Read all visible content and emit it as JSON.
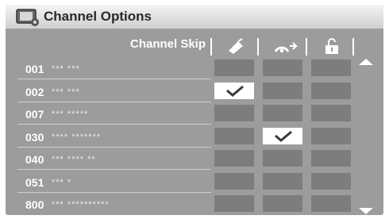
{
  "window": {
    "title": "Channel Options"
  },
  "columns": {
    "skip_label": "Channel Skip",
    "icons": [
      "antenna-off-icon",
      "favorite-arc-icon",
      "unlock-icon"
    ]
  },
  "rows": [
    {
      "number": "001",
      "name": "*** ***",
      "checks": [
        false,
        false,
        false
      ]
    },
    {
      "number": "002",
      "name": "*** ***",
      "checks": [
        true,
        false,
        false
      ]
    },
    {
      "number": "007",
      "name": "*** *****",
      "checks": [
        false,
        false,
        false
      ]
    },
    {
      "number": "030",
      "name": "**** *******",
      "checks": [
        false,
        true,
        false
      ]
    },
    {
      "number": "040",
      "name": "*** **** **",
      "checks": [
        false,
        false,
        false
      ]
    },
    {
      "number": "051",
      "name": "*** *",
      "checks": [
        false,
        false,
        false
      ]
    },
    {
      "number": "800",
      "name": "*** **********",
      "checks": [
        false,
        false,
        false
      ]
    }
  ],
  "scroll": {
    "up_icon": "scroll-up-icon",
    "down_icon": "scroll-down-icon"
  },
  "colors": {
    "panel": "#9c9c9c",
    "cell": "#7d7d7d",
    "highlight": "#ffffff"
  }
}
